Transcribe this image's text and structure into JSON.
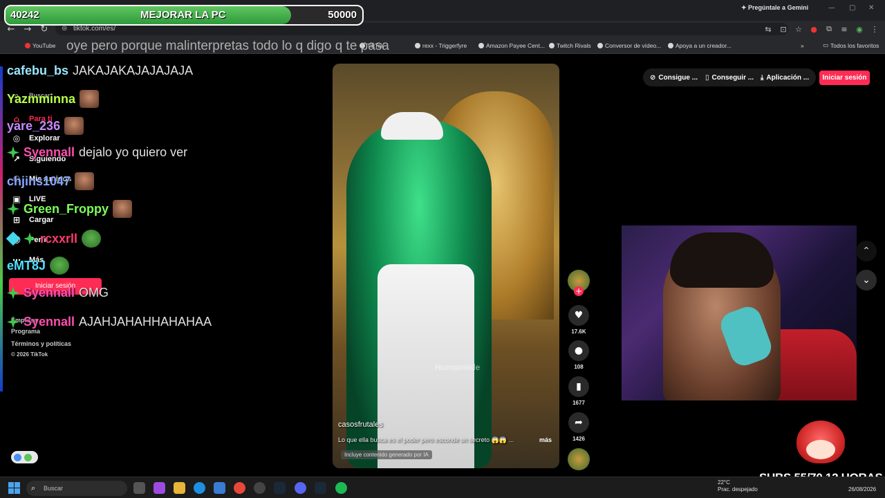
{
  "goal": {
    "current": "40242",
    "label": "MEJORAR LA PC",
    "target": "50000",
    "fraction": 0.8
  },
  "browser": {
    "url": "tiktok.com/es/",
    "gemini": "Pregúntale a Gemini",
    "bookmarks": [
      "YouTube",
      "Twitch Rivals",
      "Conversor de vídeo...",
      "Apoya a un creador...",
      "Amazon Payee Cent...",
      "TikTok",
      "rexx - Triggerfyre"
    ],
    "bookmarks_all": "Todos los favoritos"
  },
  "overlay_title": "oye pero porque malinterpretas todo lo q digo q te pasa",
  "sidebar": {
    "search": "Buscar",
    "items": [
      {
        "label": "Para ti",
        "icon": "home-icon"
      },
      {
        "label": "Explorar",
        "icon": "compass-icon"
      },
      {
        "label": "Siguiendo",
        "icon": "following-icon"
      },
      {
        "label": "Mis Amigos",
        "icon": "friends-icon"
      },
      {
        "label": "LIVE",
        "icon": "live-icon"
      },
      {
        "label": "Cargar",
        "icon": "upload-icon"
      },
      {
        "label": "Perfil",
        "icon": "profile-icon"
      },
      {
        "label": "Más",
        "icon": "more-icon"
      }
    ],
    "login": "Iniciar sesión",
    "footer_empresa": "Empresa",
    "footer_programa": "Programa",
    "footer_terms": "Términos y políticas",
    "footer_copy": "© 2026 TikTok"
  },
  "chat": [
    {
      "user": "cafebu_bs",
      "text": "JAKAJAKAJAJAJAJA",
      "color": "#9be6ff"
    },
    {
      "user": "Yazmminna",
      "text": "",
      "color": "#b7ff4a"
    },
    {
      "user": "yare_236",
      "text": "",
      "color": "#c58bff"
    },
    {
      "user": "Syennall",
      "text": "dejalo yo quiero ver",
      "color": "#ff4fb0"
    },
    {
      "user": "chjins1047",
      "text": "",
      "color": "#8aa7ff"
    },
    {
      "user": "Green_Froppy",
      "text": "",
      "color": "#7dff5c"
    },
    {
      "user": "rcxxrll",
      "text": "",
      "color": "#ff3b6a"
    },
    {
      "user": "eMT8J",
      "text": "",
      "color": "#4ee0ff"
    },
    {
      "user": "Syennall",
      "text": "OMG",
      "color": "#ff4fb0"
    },
    {
      "user": "Syennall",
      "text": "AJAHJAHAHHAHAHAA",
      "color": "#ff4fb0"
    }
  ],
  "video": {
    "author": "casosfrutales",
    "description": "Lo que ella busca es el poder pero esconde un secreto 😱😱 ...",
    "more": "más",
    "ai_label": "Incluye contenido generado por IA",
    "watermark": "Humanoide"
  },
  "actions": {
    "likes": "17.6K",
    "comments": "108",
    "saves": "1677",
    "shares": "1426"
  },
  "tiktok_top": {
    "consigue": "Consigue ...",
    "conseguir": "Conseguir ...",
    "aplicacion": "Aplicación ...",
    "login": "Iniciar sesión"
  },
  "subs": "SUBS 55/70 12 HORAS",
  "taskbar": {
    "search": "Buscar",
    "temp": "22°C",
    "weather": "Prac. despejado",
    "date": "26/08/2026"
  },
  "colors": {
    "tiktok_red": "#fe2c55",
    "goal_green": "#4fb94f"
  }
}
